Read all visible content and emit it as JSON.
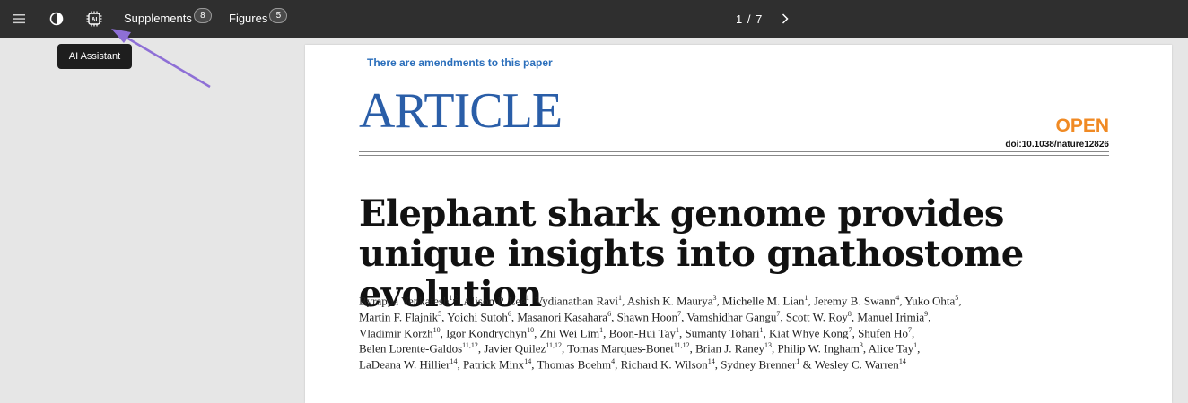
{
  "toolbar": {
    "supplements_label": "Supplements",
    "supplements_count": "8",
    "figures_label": "Figures",
    "figures_count": "5",
    "page_indicator": "1 / 7",
    "icons": [
      "menu-icon",
      "contrast-icon",
      "ai-chip-icon",
      "chevron-right-icon"
    ]
  },
  "tooltip": {
    "text": "AI Assistant"
  },
  "document": {
    "amendment_notice": "There are amendments to this paper",
    "article_label": "ARTICLE",
    "open_label": "OPEN",
    "doi": "doi:10.1038/nature12826",
    "title": "Elephant shark genome provides unique insights into gnathostome evolution",
    "authors": "Byrappa Venkatesh1,2, Alison P. Lee1, Vydianathan Ravi1, Ashish K. Maurya3, Michelle M. Lian1, Jeremy B. Swann4, Yuko Ohta5, Martin F. Flajnik5, Yoichi Sutoh6, Masanori Kasahara6, Shawn Hoon7, Vamshidhar Gangu7, Scott W. Roy8, Manuel Irimia9, Vladimir Korzh10, Igor Kondrychyn10, Zhi Wei Lim1, Boon-Hui Tay1, Sumanty Tohari1, Kiat Whye Kong7, Shufen Ho7, Belen Lorente-Galdos11,12, Javier Quilez11,12, Tomas Marques-Bonet11,12, Brian J. Raney13, Philip W. Ingham3, Alice Tay1, LaDeana W. Hillier14, Patrick Minx14, Thomas Boehm4, Richard K. Wilson14, Sydney Brenner1 & Wesley C. Warren14",
    "author_lines": [
      [
        [
          "Byrappa Venkatesh",
          "1,2"
        ],
        [
          "Alison P. Lee",
          "1"
        ],
        [
          "Vydianathan Ravi",
          "1"
        ],
        [
          "Ashish K. Maurya",
          "3"
        ],
        [
          "Michelle M. Lian",
          "1"
        ],
        [
          "Jeremy B. Swann",
          "4"
        ],
        [
          "Yuko Ohta",
          "5"
        ]
      ],
      [
        [
          "Martin F. Flajnik",
          "5"
        ],
        [
          "Yoichi Sutoh",
          "6"
        ],
        [
          "Masanori Kasahara",
          "6"
        ],
        [
          "Shawn Hoon",
          "7"
        ],
        [
          "Vamshidhar Gangu",
          "7"
        ],
        [
          "Scott W. Roy",
          "8"
        ],
        [
          "Manuel Irimia",
          "9"
        ]
      ],
      [
        [
          "Vladimir Korzh",
          "10"
        ],
        [
          "Igor Kondrychyn",
          "10"
        ],
        [
          "Zhi Wei Lim",
          "1"
        ],
        [
          "Boon-Hui Tay",
          "1"
        ],
        [
          "Sumanty Tohari",
          "1"
        ],
        [
          "Kiat Whye Kong",
          "7"
        ],
        [
          "Shufen Ho",
          "7"
        ]
      ],
      [
        [
          "Belen Lorente-Galdos",
          "11,12"
        ],
        [
          "Javier Quilez",
          "11,12"
        ],
        [
          "Tomas Marques-Bonet",
          "11,12"
        ],
        [
          "Brian J. Raney",
          "13"
        ],
        [
          "Philip W. Ingham",
          "3"
        ],
        [
          "Alice Tay",
          "1"
        ]
      ],
      [
        [
          "LaDeana W. Hillier",
          "14"
        ],
        [
          "Patrick Minx",
          "14"
        ],
        [
          "Thomas Boehm",
          "4"
        ],
        [
          "Richard K. Wilson",
          "14"
        ],
        [
          "Sydney Brenner",
          "1"
        ],
        [
          "Wesley C. Warren",
          "14"
        ]
      ]
    ]
  },
  "colors": {
    "toolbar_bg": "#2f2f2f",
    "article_blue": "#2a5ea8",
    "open_orange": "#f08a24",
    "link_blue": "#2a6ebb",
    "annotation_arrow": "#8e6fd6"
  }
}
